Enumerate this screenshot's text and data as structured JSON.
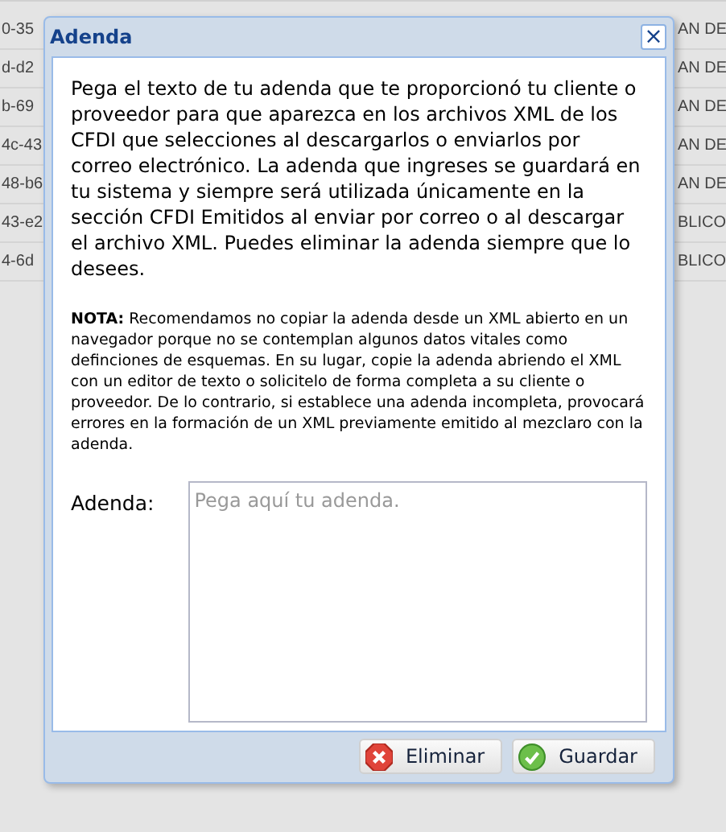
{
  "background_grid": {
    "left_cells": [
      "0-35",
      "d-d2",
      "b-69",
      "4c-43",
      "48-b6",
      "43-e2",
      "4-6d"
    ],
    "right_cells": [
      "AN DE",
      "AN DE",
      "AN DE",
      "AN DE",
      "AN DE",
      "BLICO",
      "BLICO"
    ]
  },
  "dialog": {
    "title": "Adenda",
    "close": "×",
    "intro": "Pega el texto de tu adenda que te proporcionó tu cliente o proveedor para que aparezca en los archivos XML de los CFDI que selecciones al descargarlos o enviarlos por correo electrónico. La adenda que ingreses se guardará en tu sistema y siempre será utilizada únicamente en la sección CFDI Emitidos al enviar por correo o al descargar el archivo XML. Puedes eliminar la adenda siempre que lo desees.",
    "note": "**NOTA:** Recomendamos no copiar la adenda desde un XML abierto en un navegador porque no se contemplan algunos datos vitales como definciones de esquemas. En su lugar, copie la adenda abriendo el XML con un editor de texto o solicitelo de forma completa a su cliente o proveedor. De lo contrario, si establece una adenda incompleta, provocará errores en la formación de un XML previamente emitido al mezclaro con la adenda.",
    "field": {
      "label": "Adenda:",
      "placeholder": "Pega aquí tu adenda."
    },
    "buttons": [
      {
        "kind": "delete",
        "label": "Eliminar"
      },
      {
        "kind": "save",
        "label": "Guardar"
      }
    ]
  }
}
